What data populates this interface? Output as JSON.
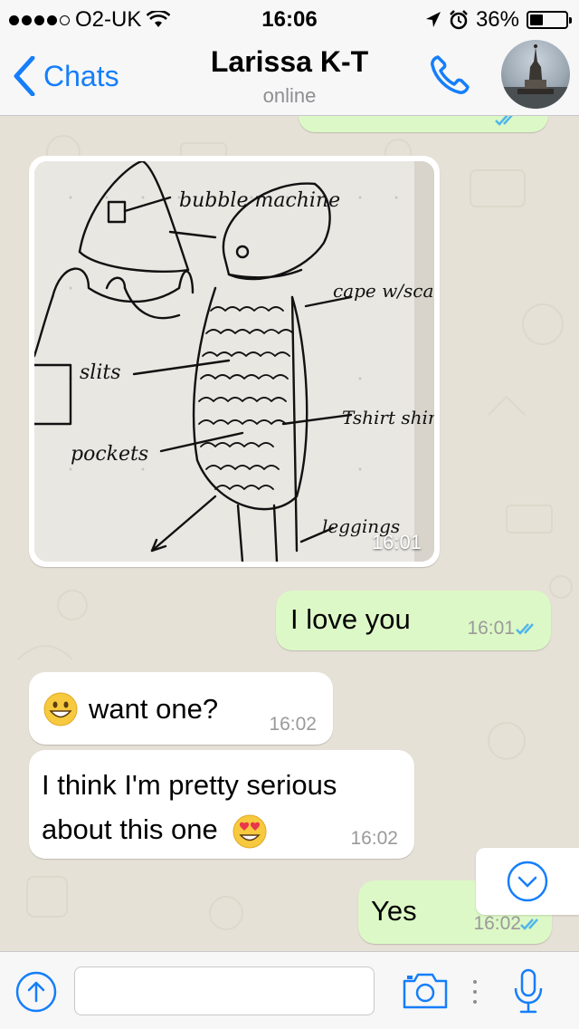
{
  "status_bar": {
    "carrier": "O2-UK",
    "time": "16:06",
    "battery": "36%",
    "battery_level": 0.36
  },
  "header": {
    "back_label": "Chats",
    "contact_name": "Larissa K-T",
    "contact_status": "online",
    "icons": [
      "chevron-left-icon",
      "phone-icon",
      "avatar"
    ]
  },
  "messages": [
    {
      "type": "image",
      "direction": "incoming",
      "time": "16:01"
    },
    {
      "type": "text",
      "direction": "outgoing",
      "text": "I love you",
      "time": "16:01",
      "read": true
    },
    {
      "type": "text",
      "direction": "incoming",
      "emoji": "grinning-face",
      "text": "want one?",
      "time": "16:02"
    },
    {
      "type": "text",
      "direction": "incoming",
      "text": "I think I'm pretty serious about this one",
      "emoji": "heart-eyes-face",
      "time": "16:02"
    },
    {
      "type": "text",
      "direction": "outgoing",
      "text": "Yes",
      "time": "16:02",
      "read": true
    }
  ],
  "sketch_labels": {
    "top": "bubble machine",
    "right1": "cape w/scaled shimmer",
    "left1": "slits",
    "right2": "Tshirt shimmer",
    "left2": "pockets",
    "bottom": "leggings"
  },
  "input_bar": {
    "placeholder": "",
    "icons": [
      "upload-icon",
      "camera-icon",
      "microphone-icon"
    ]
  },
  "colors": {
    "accent": "#157efb",
    "outgoing_bubble": "#dcf8c6",
    "incoming_bubble": "#ffffff",
    "chat_background": "#e6e1d6",
    "read_ticks": "#4fb6ec"
  }
}
